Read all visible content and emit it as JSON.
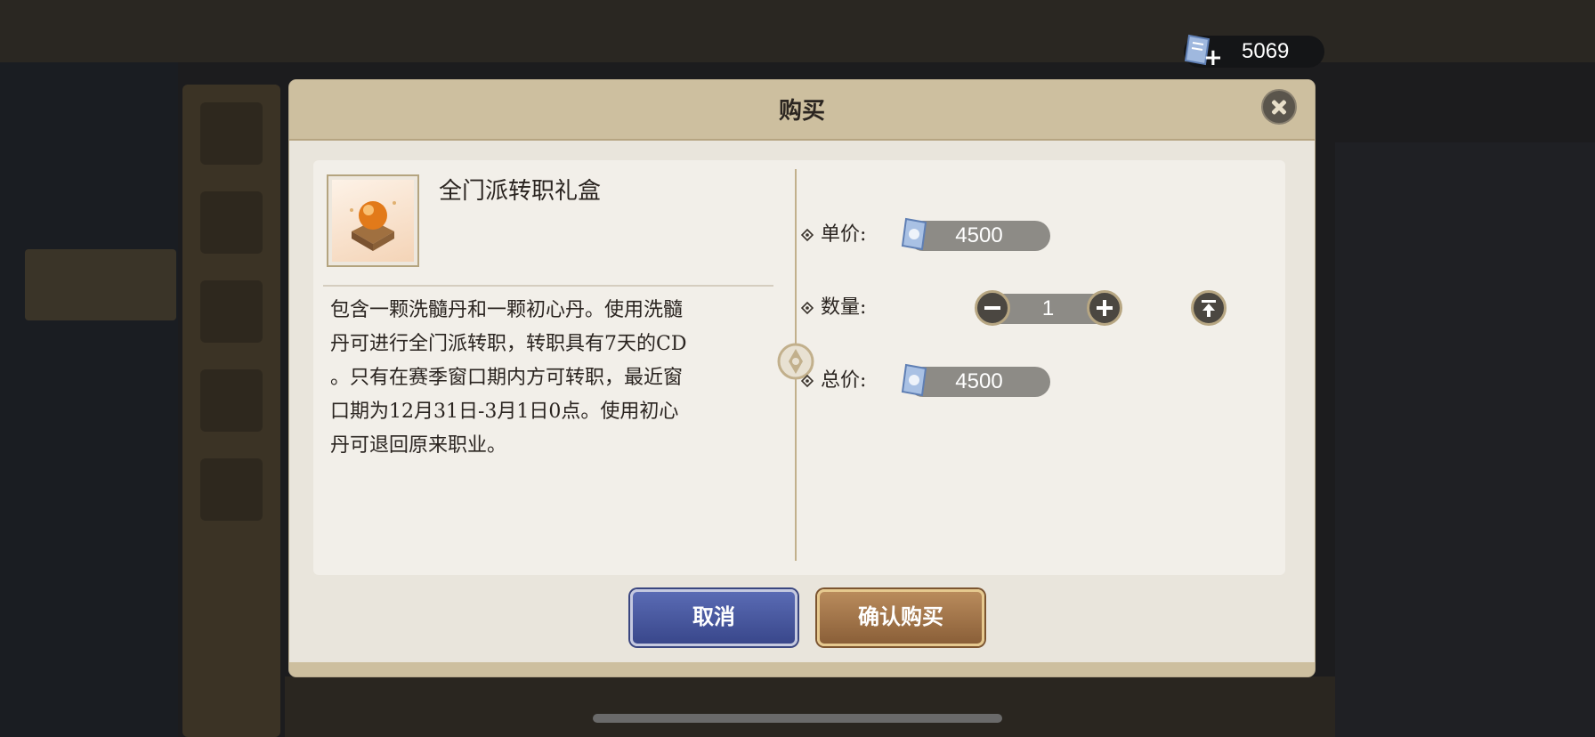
{
  "currency": {
    "icon": "ticket-icon",
    "plus": "+",
    "amount": "5069"
  },
  "dialog": {
    "title": "购买",
    "item": {
      "name": "全门派转职礼盒",
      "icon": "orb-gift-box-icon",
      "description_lines": [
        "包含一颗洗髓丹和一颗初心丹。使用洗髓",
        "丹可进行全门派转职，转职具有7天的CD",
        "。只有在赛季窗口期内方可转职，最近窗",
        "口期为12月31日-3月1日0点。使用初心",
        "丹可退回原来职业。"
      ]
    },
    "unit_price": {
      "label": "单价:",
      "value": "4500"
    },
    "quantity": {
      "label": "数量:",
      "value": "1"
    },
    "total_price": {
      "label": "总价:",
      "value": "4500"
    },
    "buttons": {
      "cancel": "取消",
      "confirm": "确认购买"
    }
  },
  "colors": {
    "header": "#cdbf9f",
    "panel": "#f2efe9",
    "cancel_button": "#4a5aa0",
    "confirm_button": "#a57548"
  }
}
